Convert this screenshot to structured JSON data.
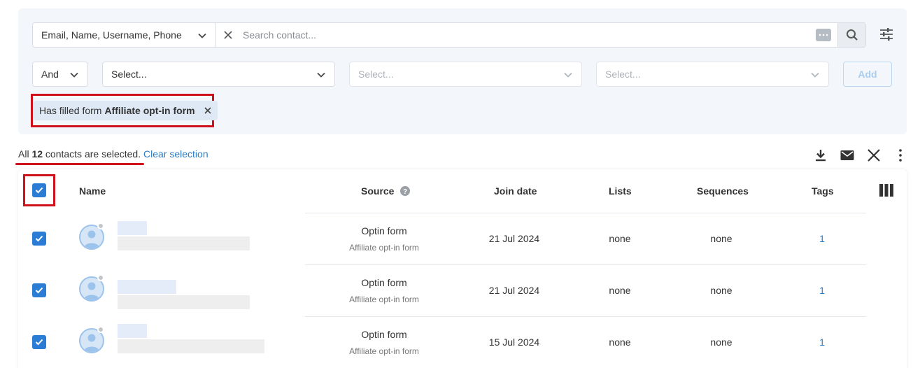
{
  "search": {
    "type_label": "Email, Name, Username, Phone",
    "placeholder": "Search contact..."
  },
  "conditions": {
    "operator": "And",
    "field_placeholder": "Select...",
    "op_placeholder": "Select...",
    "value_placeholder": "Select...",
    "add_label": "Add"
  },
  "active_filter": {
    "prefix": "Has filled form",
    "value": "Affiliate opt-in form"
  },
  "selection": {
    "prefix": "All",
    "count": "12",
    "suffix": "contacts are selected.",
    "clear_label": "Clear selection"
  },
  "columns": {
    "name": "Name",
    "source": "Source",
    "join_date": "Join date",
    "lists": "Lists",
    "sequences": "Sequences",
    "tags": "Tags"
  },
  "rows": [
    {
      "source": "Optin form",
      "source_detail": "Affiliate opt-in form",
      "join_date": "21 Jul 2024",
      "lists": "none",
      "sequences": "none",
      "tags": "1"
    },
    {
      "source": "Optin form",
      "source_detail": "Affiliate opt-in form",
      "join_date": "21 Jul 2024",
      "lists": "none",
      "sequences": "none",
      "tags": "1"
    },
    {
      "source": "Optin form",
      "source_detail": "Affiliate opt-in form",
      "join_date": "15 Jul 2024",
      "lists": "none",
      "sequences": "none",
      "tags": "1"
    }
  ],
  "icons": [
    "chevron-down-icon",
    "close-icon",
    "more-dots-icon",
    "search-icon",
    "filter-settings-icon",
    "download-icon",
    "mail-icon",
    "delete-x-icon",
    "more-vertical-icon",
    "columns-icon",
    "help-icon",
    "checkbox-checked-icon",
    "avatar-icon"
  ],
  "colors": {
    "accent": "#2a7cd4",
    "link": "#2a7cc7",
    "highlight": "#d0111b",
    "panel": "#f3f6fa"
  }
}
